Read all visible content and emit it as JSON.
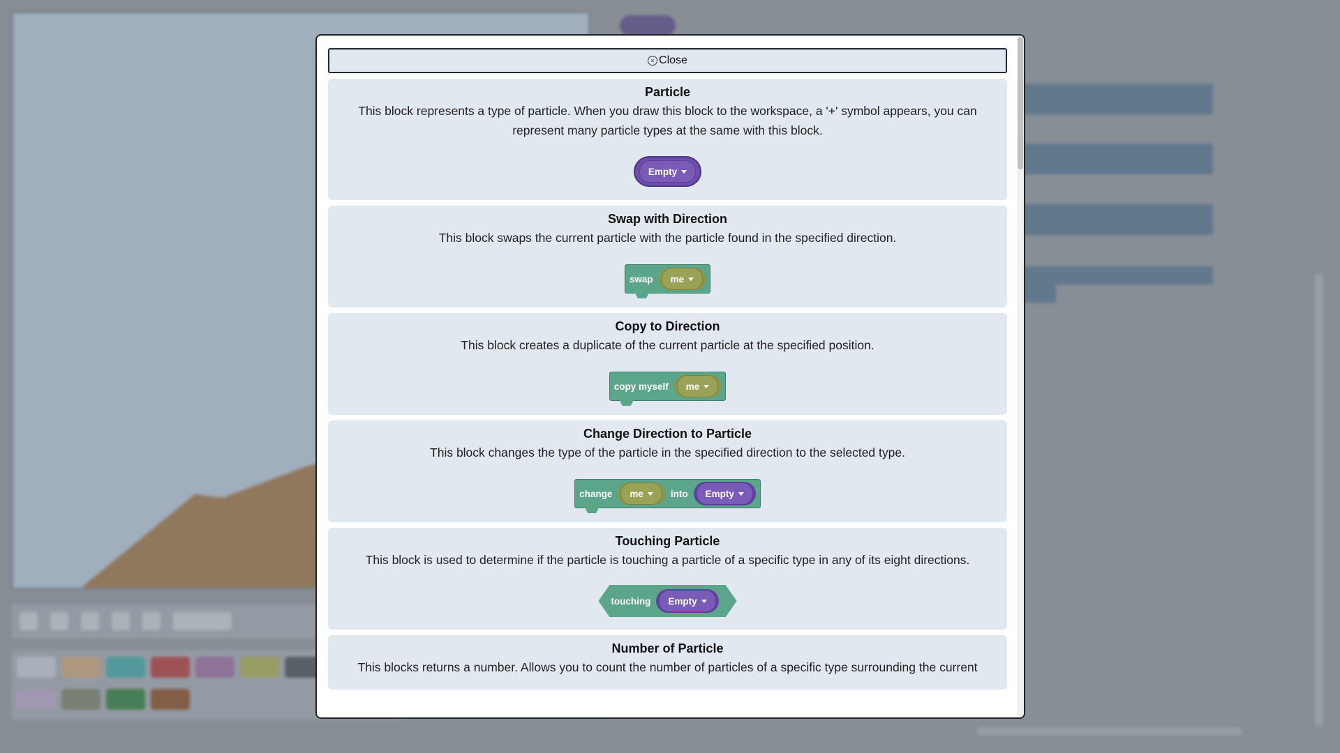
{
  "modal": {
    "close_label": "Close",
    "sections": [
      {
        "title": "Particle",
        "description": "This block represents a type of particle. When you draw this block to the workspace, a '+' symbol appears, you can represent many particle types at the same with this block.",
        "block": {
          "dropdown": "Empty"
        }
      },
      {
        "title": "Swap with Direction",
        "description": "This block swaps the current particle with the particle found in the specified direction.",
        "block": {
          "label": "swap",
          "dropdown": "me"
        }
      },
      {
        "title": "Copy to Direction",
        "description": "This block creates a duplicate of the current particle at the specified position.",
        "block": {
          "label": "copy myself",
          "dropdown": "me"
        }
      },
      {
        "title": "Change Direction to Particle",
        "description": "This block changes the type of the particle in the specified direction to the selected type.",
        "block": {
          "label": "change",
          "dropdown": "me",
          "label2": "into",
          "dropdown2": "Empty"
        }
      },
      {
        "title": "Touching Particle",
        "description": "This block is used to determine if the particle is touching a particle of a specific type in any of its eight directions.",
        "block": {
          "label": "touching",
          "dropdown": "Empty"
        }
      },
      {
        "title": "Number of Particle",
        "description": "This blocks returns a number. Allows you to count the number of particles of a specific type surrounding the current"
      }
    ]
  },
  "colors": {
    "card_bg": "#e2e8f0",
    "particle_purple": "#6b4fa8",
    "action_green": "#5ba58b",
    "direction_olive": "#9aa256",
    "sand": "#9c7343"
  },
  "background_palette_colors": [
    "#c3c9d3",
    "#c9a57a",
    "#3fa6a6",
    "#b33a3a",
    "#9a6aa0",
    "#a9ad52",
    "#4a4f55",
    "#b7a3c8",
    "#7a8068",
    "#2e7d3c",
    "#8a4a25"
  ]
}
